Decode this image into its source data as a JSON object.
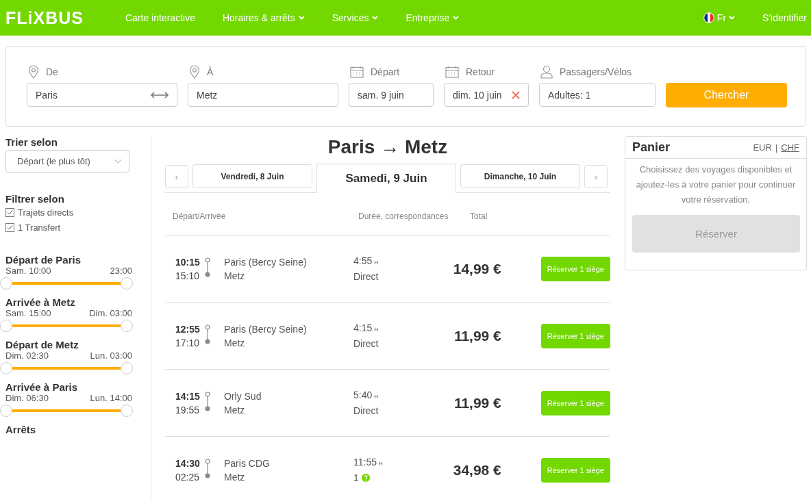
{
  "header": {
    "logo": "FLiXBUS",
    "nav": [
      {
        "label": "Carte interactive",
        "dropdown": false
      },
      {
        "label": "Horaires & arrêts",
        "dropdown": true
      },
      {
        "label": "Services",
        "dropdown": true
      },
      {
        "label": "Entreprise",
        "dropdown": true
      }
    ],
    "language": "Fr",
    "login": "S'identifier"
  },
  "search": {
    "fields": [
      {
        "kind": "place",
        "label": "De",
        "value": "Paris",
        "swap": true,
        "clear": false
      },
      {
        "kind": "place",
        "label": "À",
        "value": "Metz",
        "swap": false,
        "clear": false
      },
      {
        "kind": "date",
        "label": "Départ",
        "value": "sam. 9 juin",
        "swap": false,
        "clear": false
      },
      {
        "kind": "date",
        "label": "Retour",
        "value": "dim. 10 juin",
        "swap": false,
        "clear": true
      },
      {
        "kind": "person",
        "label": "Passagers/Vélos",
        "value": "Adultes: 1",
        "swap": false,
        "clear": false
      }
    ],
    "button": "Chercher"
  },
  "sidebar": {
    "sort_title": "Trier selon",
    "sort_value": "Départ (le plus tôt)",
    "filter_title": "Filtrer selon",
    "filters": [
      {
        "label": "Trajets directs",
        "checked": true
      },
      {
        "label": "1 Transfert",
        "checked": true
      }
    ],
    "ranges": [
      {
        "title": "Départ de Paris",
        "from": "Sam. 10:00",
        "to": "23:00"
      },
      {
        "title": "Arrivée à Metz",
        "from": "Sam. 15:00",
        "to": "Dim. 03:00"
      },
      {
        "title": "Départ de Metz",
        "from": "Dim. 02:30",
        "to": "Lun. 03:00"
      },
      {
        "title": "Arrivée à Paris",
        "from": "Dim. 06:30",
        "to": "Lun. 14:00"
      }
    ],
    "stops_title": "Arrêts"
  },
  "results": {
    "title": "Paris → Metz",
    "prev": "‹",
    "next": "›",
    "days": [
      {
        "label": "Vendredi, 8 Juin",
        "selected": false
      },
      {
        "label": "Samedi, 9 Juin",
        "selected": true
      },
      {
        "label": "Dimanche, 10 Juin",
        "selected": false
      }
    ],
    "columns": [
      "Départ/Arrivée",
      "Durée, correspondances",
      "Total"
    ],
    "rows": [
      {
        "departure": "10:15",
        "arrival": "15:10",
        "from": "Paris (Bercy Seine)",
        "to": "Metz",
        "duration": "4:55",
        "unit": "H",
        "connections": "Direct",
        "help": false,
        "price": "14,99 €",
        "button": "Réserver 1 siège"
      },
      {
        "departure": "12:55",
        "arrival": "17:10",
        "from": "Paris (Bercy Seine)",
        "to": "Metz",
        "duration": "4:15",
        "unit": "H",
        "connections": "Direct",
        "help": false,
        "price": "11,99 €",
        "button": "Réserver 1 siège"
      },
      {
        "departure": "14:15",
        "arrival": "19:55",
        "from": "Orly Sud",
        "to": "Metz",
        "duration": "5:40",
        "unit": "H",
        "connections": "Direct",
        "help": false,
        "price": "11,99 €",
        "button": "Réserver 1 siège"
      },
      {
        "departure": "14:30",
        "arrival": "02:25",
        "from": "Paris CDG",
        "to": "Metz",
        "duration": "11:55",
        "unit": "H",
        "connections": "1",
        "help": true,
        "price": "34,98 €",
        "button": "Réserver 1 siège"
      }
    ]
  },
  "cart": {
    "title": "Panier",
    "currencies": [
      {
        "label": "EUR",
        "selected": true
      },
      {
        "label": "CHF",
        "selected": false
      }
    ],
    "separator": "|",
    "message": "Choisissez des voyages disponibles et ajoutez-les à votre panier pour continuer votre réservation.",
    "button": "Réserver",
    "disabled": true
  }
}
